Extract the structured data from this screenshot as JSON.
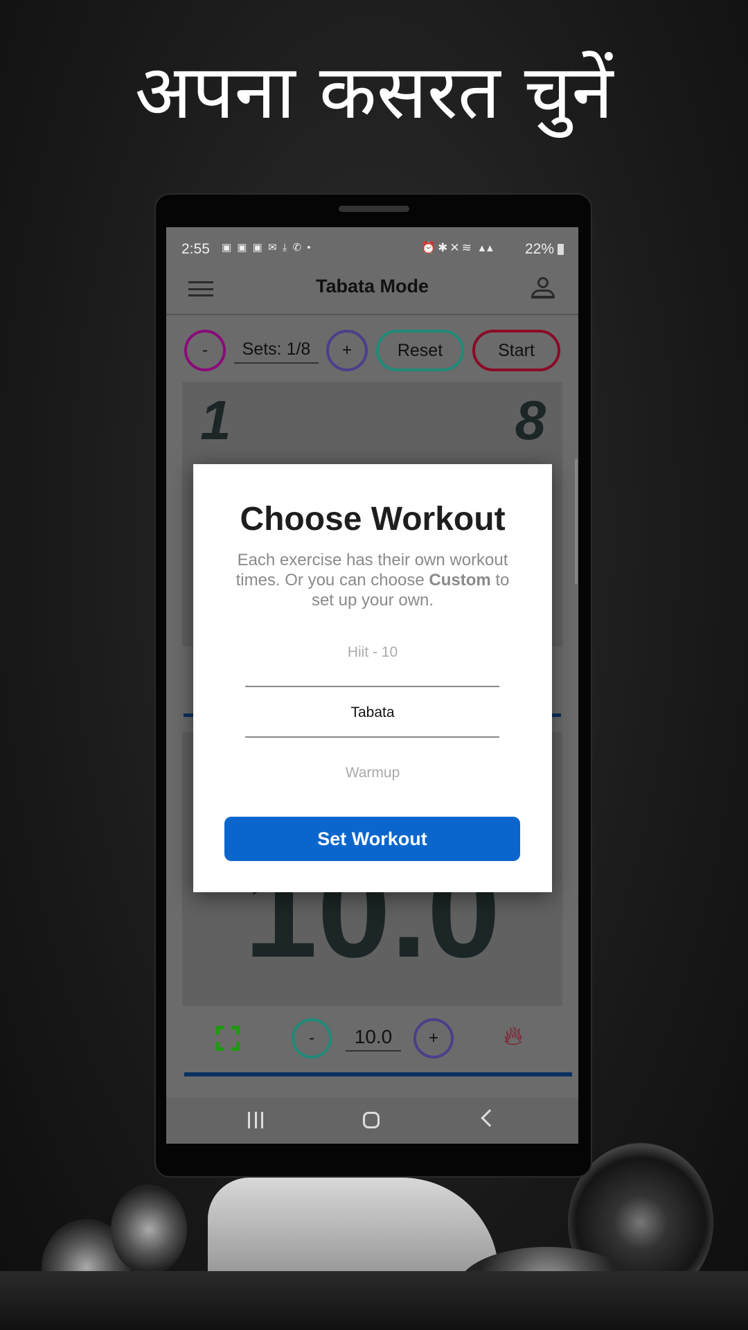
{
  "headline": "अपना कसरत चुनें",
  "status_bar": {
    "time": "2:55",
    "battery": "22%",
    "left_icons": [
      "imdb-icon",
      "imdb-icon",
      "imdb-icon",
      "mail-icon",
      "download-icon",
      "missed-call-icon",
      "dot-icon"
    ],
    "right_icons": [
      "alarm-icon",
      "bluetooth-icon",
      "mute-icon",
      "wifi-icon",
      "5g-icon",
      "signal-icon",
      "battery-charging-icon"
    ]
  },
  "app_bar": {
    "title": "Tabata Mode",
    "menu_icon": "hamburger-icon",
    "profile_icon": "person-icon"
  },
  "controls": {
    "minus": "-",
    "sets": "Sets: 1/8",
    "plus": "+",
    "reset": "Reset",
    "start": "Start"
  },
  "counter": {
    "current": "1",
    "total": "8"
  },
  "timer": {
    "big_value": "10.0"
  },
  "bottom_row": {
    "minus": "-",
    "value": "10.0",
    "plus": "+",
    "fullscreen_icon": "fullscreen-icon",
    "fire_icon": "fire-icon"
  },
  "dialog": {
    "title": "Choose Workout",
    "desc_pre": "Each exercise has their own workout times. Or you can choose ",
    "desc_bold": "Custom",
    "desc_post": " to set up your own.",
    "options": [
      "Hiit - 10",
      "Tabata",
      "Warmup"
    ],
    "selected": "Tabata",
    "button": "Set Workout"
  },
  "colors": {
    "accent_blue": "#0a66cc",
    "minus_ring": "#8a0a7a",
    "plus_ring": "#4a3f8a",
    "reset_ring": "#1f8a78",
    "start_ring": "#8a0a25",
    "fire": "#8a0a20",
    "fullscreen": "#1e9a10",
    "progress_line": "#0a3060"
  }
}
